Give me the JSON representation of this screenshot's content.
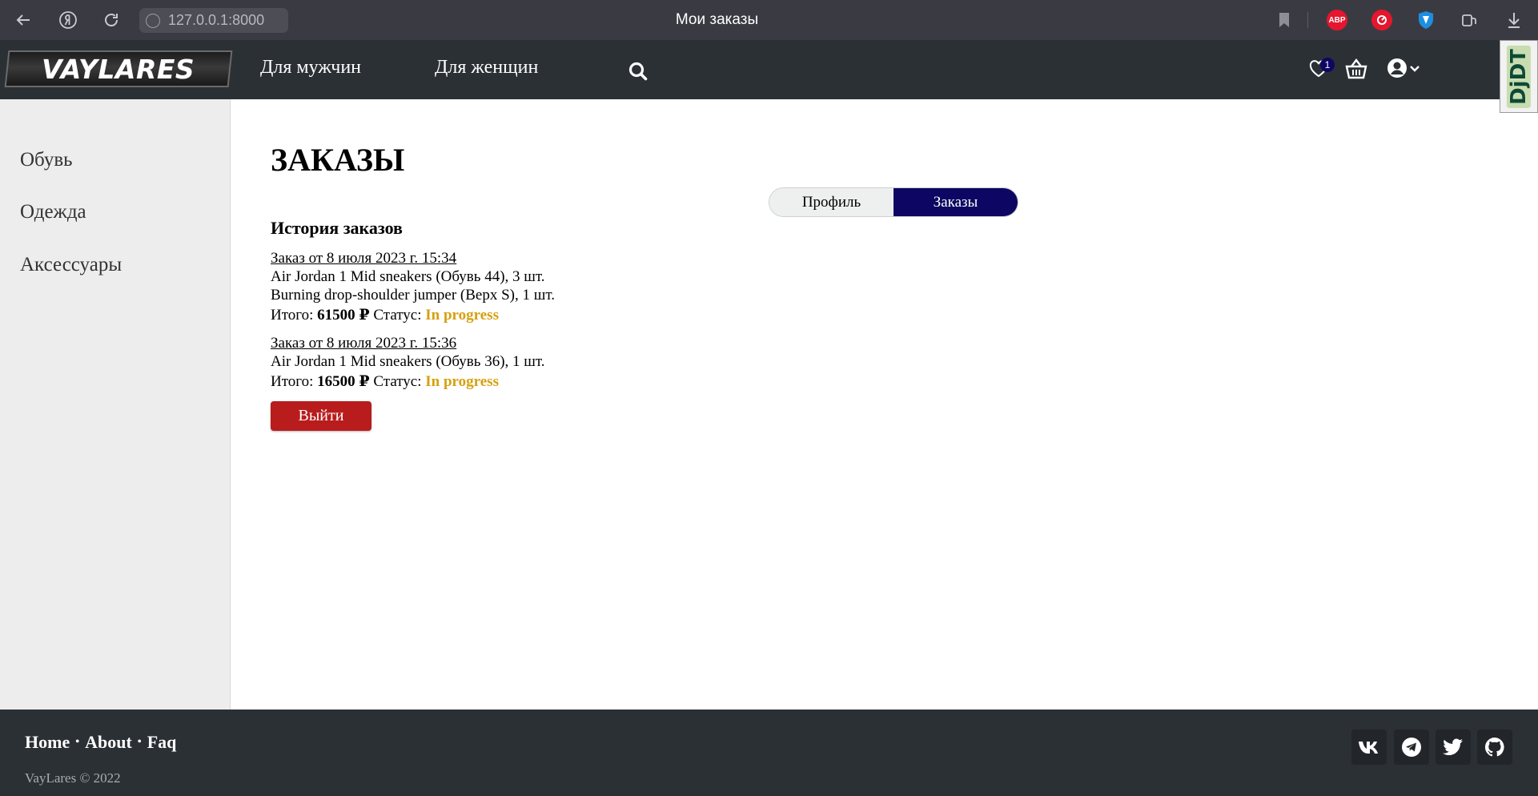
{
  "browser": {
    "url": "127.0.0.1:8000",
    "tab_title": "Мои заказы",
    "extensions": [
      {
        "name": "adblock",
        "label": "ABP",
        "color": "#e5162d"
      },
      {
        "name": "readlater",
        "label": "",
        "color": "#e5162d"
      },
      {
        "name": "shield",
        "label": "",
        "color": "#1d8ee0"
      }
    ]
  },
  "header": {
    "logo_text": "VAYLARES",
    "nav": [
      "Для мужчин",
      "Для женщин"
    ],
    "favorites_count": "1",
    "debug_toolbar_label": "DjDT"
  },
  "sidebar": {
    "items": [
      "Обувь",
      "Одежда",
      "Аксессуары"
    ]
  },
  "main": {
    "title": "ЗАКАЗЫ",
    "tabs": [
      {
        "label": "Профиль",
        "active": false
      },
      {
        "label": "Заказы",
        "active": true
      }
    ],
    "history_title": "История заказов",
    "orders": [
      {
        "title": "Заказ от 8 июля 2023 г. 15:34",
        "items": [
          "Air Jordan 1 Mid sneakers (Обувь 44), 3 шт.",
          "Burning drop-shoulder jumper (Верх S), 1 шт."
        ],
        "total_label": "Итого:",
        "total": "61500 ₽",
        "status_label": "Статус:",
        "status": "In progress"
      },
      {
        "title": "Заказ от 8 июля 2023 г. 15:36",
        "items": [
          "Air Jordan 1 Mid sneakers (Обувь 36), 1 шт."
        ],
        "total_label": "Итого:",
        "total": "16500 ₽",
        "status_label": "Статус:",
        "status": "In progress"
      }
    ],
    "logout_label": "Выйти"
  },
  "footer": {
    "links": [
      "Home",
      "About",
      "Faq"
    ],
    "separator": "•",
    "copyright": "VayLares © 2022",
    "social": [
      "vk-icon",
      "telegram-icon",
      "twitter-icon",
      "github-icon"
    ]
  },
  "colors": {
    "header_bg": "#2b3035",
    "accent": "#0d0763",
    "status": "#d6a00e",
    "logout": "#b91c1c"
  }
}
